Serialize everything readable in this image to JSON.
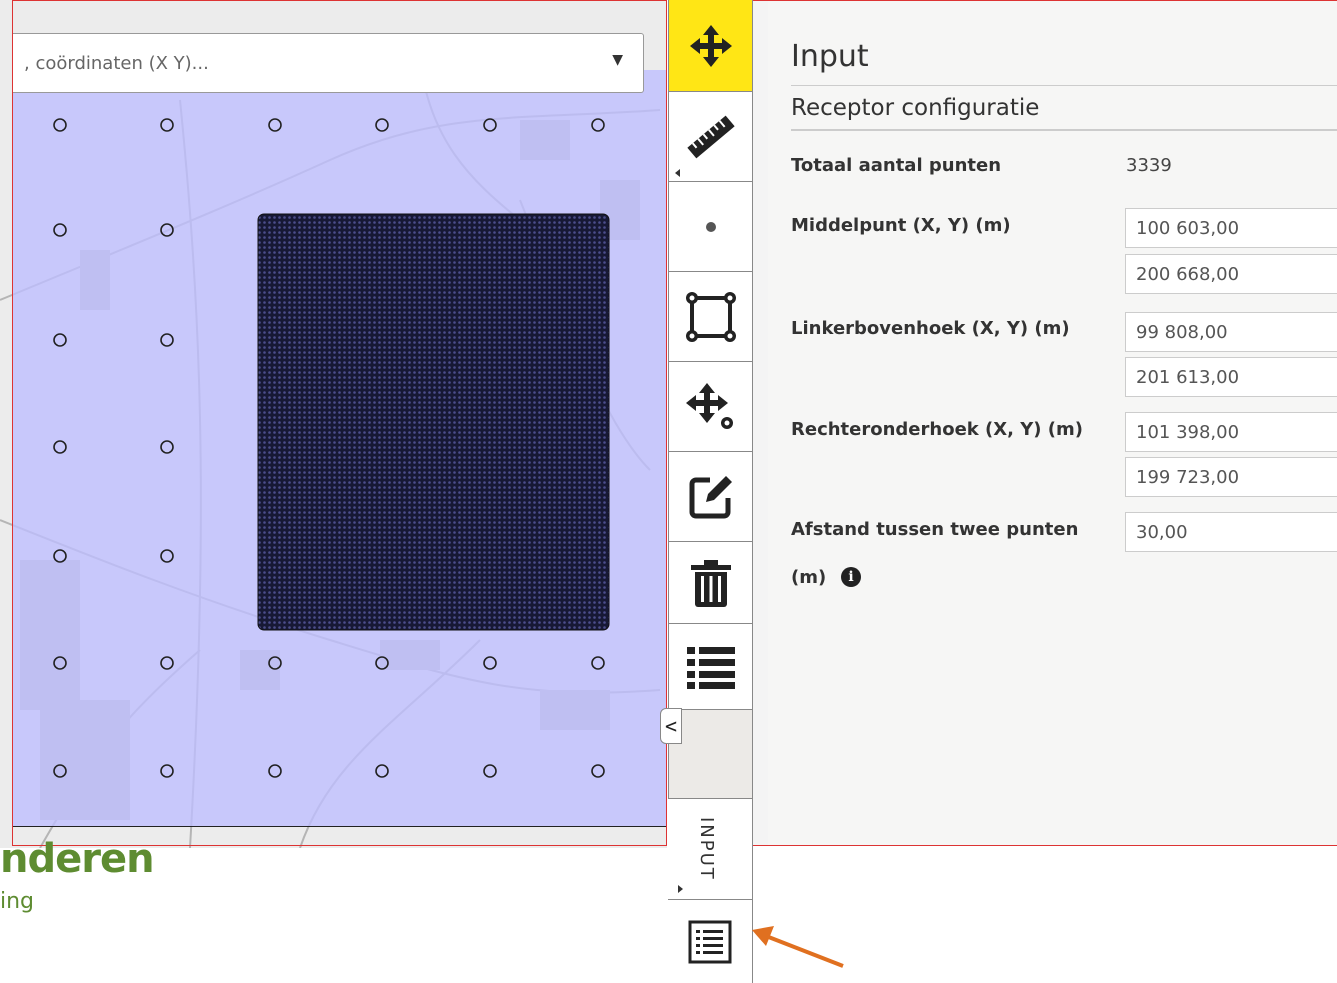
{
  "search": {
    "placeholder": ", coördinaten (X Y)...",
    "dropdown_icon": "caret-down-icon"
  },
  "logo": {
    "word": "nderen",
    "sub": "ing",
    "color": "#5e8c31"
  },
  "toolbar": {
    "tools": [
      {
        "icon": "move-icon",
        "active": true
      },
      {
        "icon": "ruler-icon",
        "has_submenu": true
      },
      {
        "icon": "point-icon"
      },
      {
        "icon": "rectangle-select-icon"
      },
      {
        "icon": "move-point-icon"
      },
      {
        "icon": "edit-icon"
      },
      {
        "icon": "trash-icon"
      },
      {
        "icon": "list-icon"
      }
    ],
    "collapse_glyph": "<",
    "input_tab_label": "INPUT",
    "bottom_tool_icon": "list-view-icon",
    "active_color": "#ffe615"
  },
  "panel": {
    "title": "Input",
    "section": "Receptor configuratie",
    "total_label": "Totaal aantal punten",
    "total_value": "3339",
    "center_label": "Middelpunt (X, Y) (m)",
    "center_x": "100 603,00",
    "center_y": "200 668,00",
    "topleft_label": "Linkerbovenhoek (X, Y) (m)",
    "topleft_x": "99 808,00",
    "topleft_y": "201 613,00",
    "bottomright_label": "Rechteronderhoek (X, Y) (m)",
    "bottomright_x": "101 398,00",
    "bottomright_y": "199 723,00",
    "distance_label_1": "Afstand tussen twee punten",
    "distance_label_2": "(m)",
    "distance_value": "30,00",
    "info_icon": "info-icon"
  },
  "annotation": {
    "arrow_color": "#e07020"
  }
}
